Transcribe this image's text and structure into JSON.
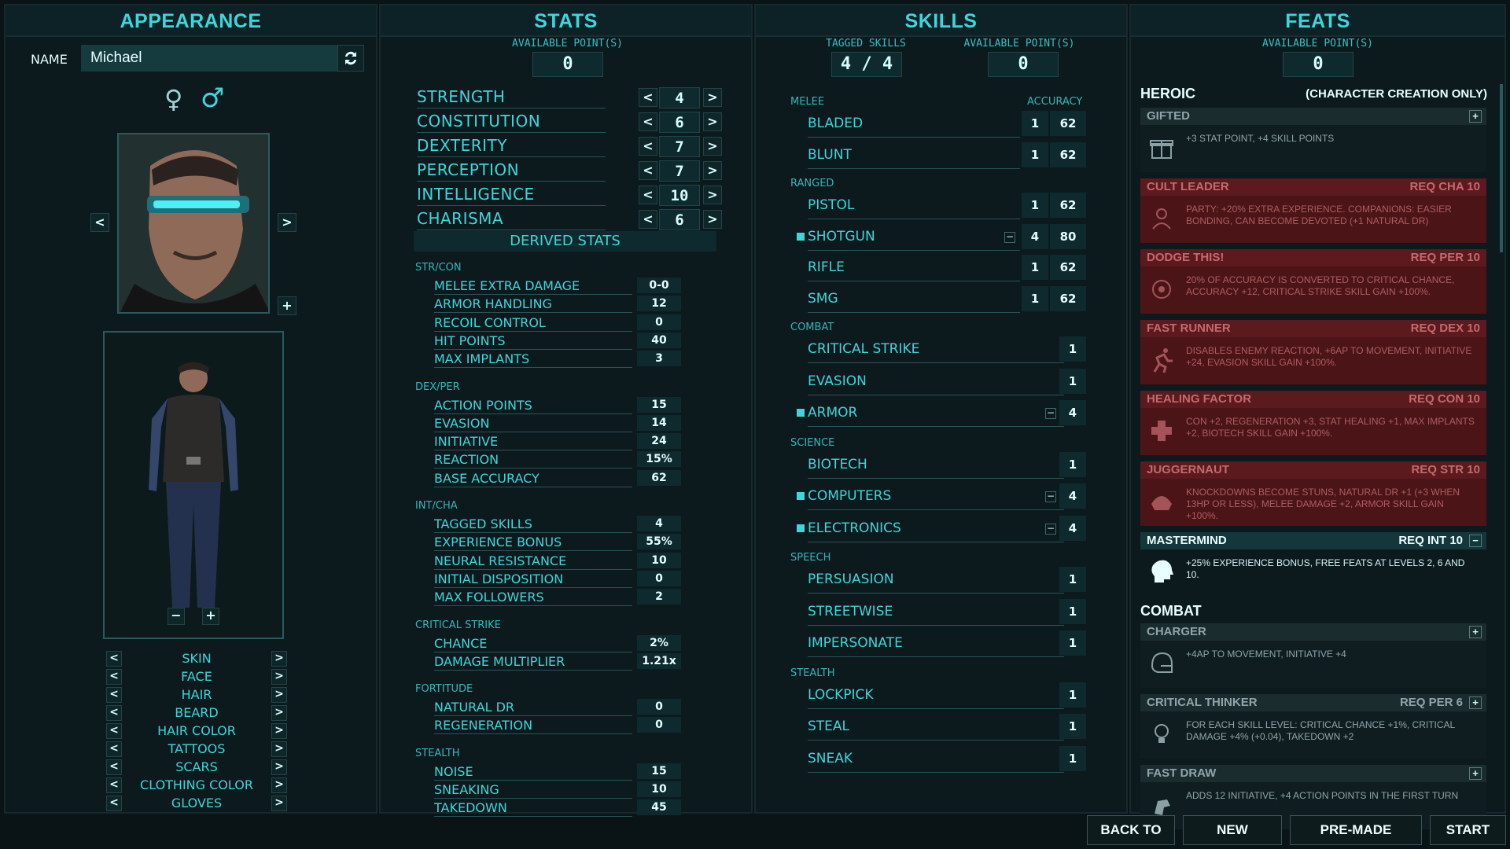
{
  "appearance": {
    "title": "APPEARANCE",
    "name_label": "NAME",
    "name_value": "Michael",
    "female_symbol": "♀",
    "male_symbol": "♂",
    "options": [
      "SKIN",
      "FACE",
      "HAIR",
      "BEARD",
      "HAIR COLOR",
      "TATTOOS",
      "SCARS",
      "CLOTHING COLOR",
      "GLOVES"
    ]
  },
  "stats": {
    "title": "STATS",
    "available_label": "AVAILABLE POINT(S)",
    "available": "0",
    "primary": [
      {
        "name": "STRENGTH",
        "value": "4"
      },
      {
        "name": "CONSTITUTION",
        "value": "6"
      },
      {
        "name": "DEXTERITY",
        "value": "7"
      },
      {
        "name": "PERCEPTION",
        "value": "7"
      },
      {
        "name": "INTELLIGENCE",
        "value": "10"
      },
      {
        "name": "CHARISMA",
        "value": "6"
      }
    ],
    "derived_title": "DERIVED STATS",
    "groups": [
      {
        "label": "STR/CON",
        "rows": [
          {
            "name": "MELEE EXTRA DAMAGE",
            "value": "0-0"
          },
          {
            "name": "ARMOR HANDLING",
            "value": "12"
          },
          {
            "name": "RECOIL CONTROL",
            "value": "0"
          },
          {
            "name": "HIT POINTS",
            "value": "40"
          },
          {
            "name": "MAX IMPLANTS",
            "value": "3"
          }
        ]
      },
      {
        "label": "DEX/PER",
        "rows": [
          {
            "name": "ACTION POINTS",
            "value": "15"
          },
          {
            "name": "EVASION",
            "value": "14"
          },
          {
            "name": "INITIATIVE",
            "value": "24"
          },
          {
            "name": "REACTION",
            "value": "15%"
          },
          {
            "name": "BASE ACCURACY",
            "value": "62"
          }
        ]
      },
      {
        "label": "INT/CHA",
        "rows": [
          {
            "name": "TAGGED SKILLS",
            "value": "4"
          },
          {
            "name": "EXPERIENCE BONUS",
            "value": "55%"
          },
          {
            "name": "NEURAL RESISTANCE",
            "value": "10"
          },
          {
            "name": "INITIAL DISPOSITION",
            "value": "0"
          },
          {
            "name": "MAX FOLLOWERS",
            "value": "2"
          }
        ]
      },
      {
        "label": "CRITICAL STRIKE",
        "rows": [
          {
            "name": "CHANCE",
            "value": "2%"
          },
          {
            "name": "DAMAGE MULTIPLIER",
            "value": "1.21x"
          }
        ]
      },
      {
        "label": "FORTITUDE",
        "rows": [
          {
            "name": "NATURAL DR",
            "value": "0"
          },
          {
            "name": "REGENERATION",
            "value": "0"
          }
        ]
      },
      {
        "label": "STEALTH",
        "rows": [
          {
            "name": "NOISE",
            "value": "15"
          },
          {
            "name": "SNEAKING",
            "value": "10"
          },
          {
            "name": "TAKEDOWN",
            "value": "45"
          }
        ]
      }
    ]
  },
  "skills": {
    "title": "SKILLS",
    "tagged_label": "TAGGED SKILLS",
    "tagged": "4 / 4",
    "available_label": "AVAILABLE POINT(S)",
    "available": "0",
    "accuracy_label": "ACCURACY",
    "groups": [
      {
        "label": "MELEE",
        "rows": [
          {
            "name": "BLADED",
            "value": "1",
            "acc": "62",
            "tagged": false
          },
          {
            "name": "BLUNT",
            "value": "1",
            "acc": "62",
            "tagged": false
          }
        ]
      },
      {
        "label": "RANGED",
        "rows": [
          {
            "name": "PISTOL",
            "value": "1",
            "acc": "62",
            "tagged": false
          },
          {
            "name": "SHOTGUN",
            "value": "4",
            "acc": "80",
            "tagged": true
          },
          {
            "name": "RIFLE",
            "value": "1",
            "acc": "62",
            "tagged": false
          },
          {
            "name": "SMG",
            "value": "1",
            "acc": "62",
            "tagged": false
          }
        ]
      },
      {
        "label": "COMBAT",
        "rows": [
          {
            "name": "CRITICAL STRIKE",
            "value": "1",
            "tagged": false
          },
          {
            "name": "EVASION",
            "value": "1",
            "tagged": false
          },
          {
            "name": "ARMOR",
            "value": "4",
            "tagged": true
          }
        ]
      },
      {
        "label": "SCIENCE",
        "rows": [
          {
            "name": "BIOTECH",
            "value": "1",
            "tagged": false
          },
          {
            "name": "COMPUTERS",
            "value": "4",
            "tagged": true
          },
          {
            "name": "ELECTRONICS",
            "value": "4",
            "tagged": true
          }
        ]
      },
      {
        "label": "SPEECH",
        "rows": [
          {
            "name": "PERSUASION",
            "value": "1",
            "tagged": false
          },
          {
            "name": "STREETWISE",
            "value": "1",
            "tagged": false
          },
          {
            "name": "IMPERSONATE",
            "value": "1",
            "tagged": false
          }
        ]
      },
      {
        "label": "STEALTH",
        "rows": [
          {
            "name": "LOCKPICK",
            "value": "1",
            "tagged": false
          },
          {
            "name": "STEAL",
            "value": "1",
            "tagged": false
          },
          {
            "name": "SNEAK",
            "value": "1",
            "tagged": false
          }
        ]
      }
    ]
  },
  "feats": {
    "title": "FEATS",
    "available_label": "AVAILABLE POINT(S)",
    "available": "0",
    "heroic_label": "HEROIC",
    "heroic_note": "(CHARACTER CREATION ONLY)",
    "combat_label": "COMBAT",
    "heroic": [
      {
        "name": "GIFTED",
        "req": "",
        "desc": "+3 STAT POINT, +4 SKILL POINTS",
        "state": "grey",
        "icon": "gift-icon",
        "btn": "+"
      },
      {
        "name": "CULT LEADER",
        "req": "REQ CHA 10",
        "desc": "PARTY: +20% EXTRA EXPERIENCE. COMPANIONS: EASIER BONDING, CAN BECOME DEVOTED (+1 NATURAL DR)",
        "state": "red",
        "icon": "cult-icon",
        "btn": ""
      },
      {
        "name": "DODGE THIS!",
        "req": "REQ PER 10",
        "desc": "20% OF ACCURACY IS CONVERTED TO CRITICAL CHANCE, ACCURACY +12, CRITICAL STRIKE SKILL GAIN +100%.",
        "state": "red",
        "icon": "target-icon",
        "btn": ""
      },
      {
        "name": "FAST RUNNER",
        "req": "REQ DEX 10",
        "desc": "DISABLES ENEMY REACTION, +6AP TO MOVEMENT, INITIATIVE +24, EVASION SKILL GAIN +100%.",
        "state": "red",
        "icon": "runner-icon",
        "btn": ""
      },
      {
        "name": "HEALING FACTOR",
        "req": "REQ CON 10",
        "desc": "CON +2, REGENERATION +3, STAT HEALING +1, MAX IMPLANTS +2, BIOTECH SKILL GAIN +100%.",
        "state": "red",
        "icon": "medical-cross-icon",
        "btn": ""
      },
      {
        "name": "JUGGERNAUT",
        "req": "REQ STR 10",
        "desc": "KNOCKDOWNS BECOME STUNS, NATURAL DR +1 (+3 WHEN 13HP OR LESS), MELEE DAMAGE +2, ARMOR SKILL GAIN +100%.",
        "state": "red",
        "icon": "helmet-icon",
        "btn": ""
      },
      {
        "name": "MASTERMIND",
        "req": "REQ INT 10",
        "desc": "+25% EXPERIENCE BONUS, FREE FEATS AT LEVELS 2, 6 AND 10.",
        "state": "active",
        "icon": "brain-head-icon",
        "btn": "−"
      }
    ],
    "combat": [
      {
        "name": "CHARGER",
        "req": "",
        "desc": "+4AP TO MOVEMENT, INITIATIVE +4",
        "state": "grey",
        "icon": "football-helmet-icon",
        "btn": "+"
      },
      {
        "name": "CRITICAL THINKER",
        "req": "REQ PER 6",
        "desc": "FOR EACH SKILL LEVEL: CRITICAL CHANCE +1%, CRITICAL DAMAGE +4% (+0.04), TAKEDOWN +2",
        "state": "grey",
        "icon": "lightbulb-icon",
        "btn": "+"
      },
      {
        "name": "FAST DRAW",
        "req": "",
        "desc": "ADDS 12 INITIATIVE, +4 ACTION POINTS IN THE FIRST TURN",
        "state": "grey",
        "icon": "holster-icon",
        "btn": "+"
      }
    ]
  },
  "buttons": {
    "back": "BACK TO MENU",
    "new": "NEW CHARACTER",
    "premade": "PRE-MADE CHARACTER",
    "start": "START GAME"
  }
}
